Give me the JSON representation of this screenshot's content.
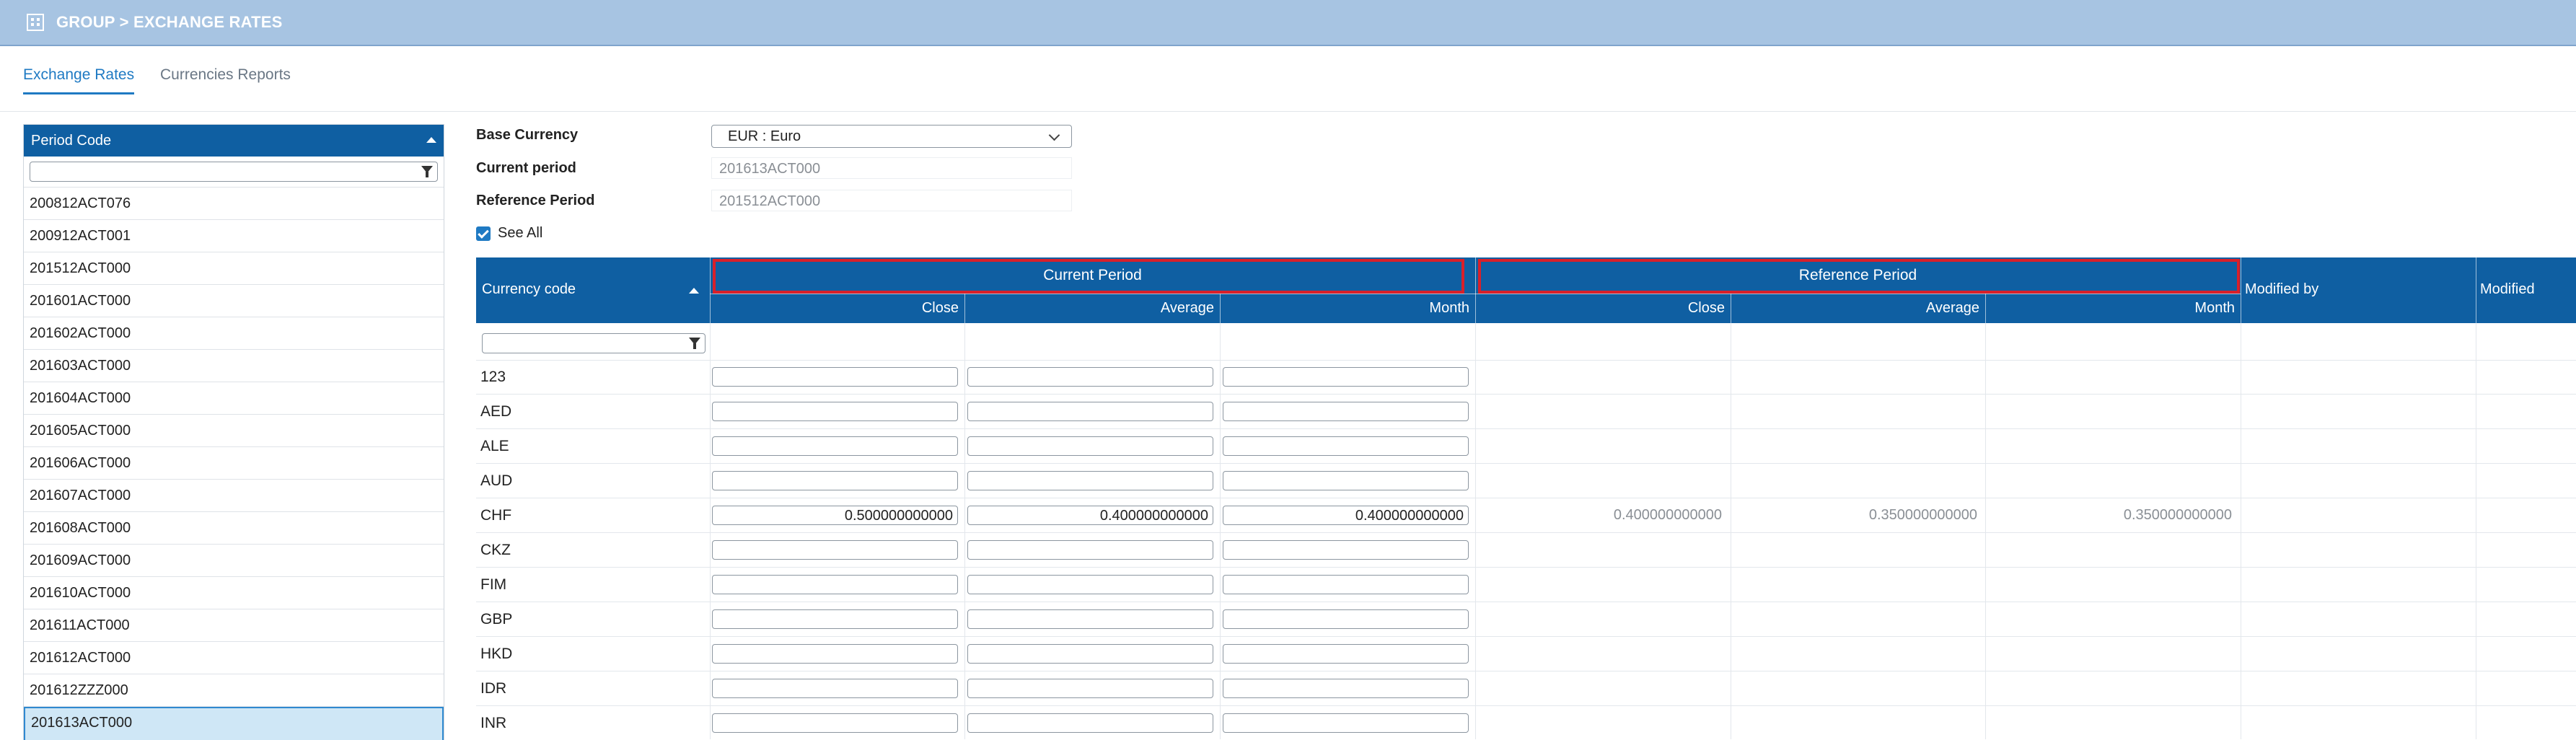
{
  "header": {
    "title": "GROUP > EXCHANGE RATES",
    "icon": "building-icon"
  },
  "tabs": [
    {
      "label": "Exchange Rates",
      "active": true
    },
    {
      "label": "Currencies Reports",
      "active": false
    }
  ],
  "period_panel": {
    "header": "Period Code",
    "filter_value": "",
    "items": [
      "200812ACT076",
      "200912ACT001",
      "201512ACT000",
      "201601ACT000",
      "201602ACT000",
      "201603ACT000",
      "201604ACT000",
      "201605ACT000",
      "201606ACT000",
      "201607ACT000",
      "201608ACT000",
      "201609ACT000",
      "201610ACT000",
      "201611ACT000",
      "201612ACT000",
      "201612ZZZ000",
      "201613ACT000"
    ],
    "selected": "201613ACT000"
  },
  "form": {
    "base_currency_label": "Base Currency",
    "base_currency_value": "EUR : Euro",
    "current_period_label": "Current period",
    "current_period_value": "201613ACT000",
    "reference_period_label": "Reference Period",
    "reference_period_value": "201512ACT000",
    "see_all_label": "See All",
    "see_all_checked": true
  },
  "grid": {
    "currency_code_header": "Currency code",
    "current_period_header": "Current Period",
    "reference_period_header": "Reference Period",
    "modified_by_header": "Modified by",
    "modified_header": "Modified",
    "sub_headers": {
      "close": "Close",
      "average": "Average",
      "month": "Month"
    },
    "rows": [
      {
        "code": "123",
        "cur": [
          "",
          "",
          ""
        ],
        "ref": [
          "",
          "",
          ""
        ]
      },
      {
        "code": "AED",
        "cur": [
          "",
          "",
          ""
        ],
        "ref": [
          "",
          "",
          ""
        ]
      },
      {
        "code": "ALE",
        "cur": [
          "",
          "",
          ""
        ],
        "ref": [
          "",
          "",
          ""
        ]
      },
      {
        "code": "AUD",
        "cur": [
          "",
          "",
          ""
        ],
        "ref": [
          "",
          "",
          ""
        ]
      },
      {
        "code": "CHF",
        "cur": [
          "0.500000000000",
          "0.400000000000",
          "0.400000000000"
        ],
        "ref": [
          "0.400000000000",
          "0.350000000000",
          "0.350000000000"
        ]
      },
      {
        "code": "CKZ",
        "cur": [
          "",
          "",
          ""
        ],
        "ref": [
          "",
          "",
          ""
        ]
      },
      {
        "code": "FIM",
        "cur": [
          "",
          "",
          ""
        ],
        "ref": [
          "",
          "",
          ""
        ]
      },
      {
        "code": "GBP",
        "cur": [
          "",
          "",
          ""
        ],
        "ref": [
          "",
          "",
          ""
        ]
      },
      {
        "code": "HKD",
        "cur": [
          "",
          "",
          ""
        ],
        "ref": [
          "",
          "",
          ""
        ]
      },
      {
        "code": "IDR",
        "cur": [
          "",
          "",
          ""
        ],
        "ref": [
          "",
          "",
          ""
        ]
      },
      {
        "code": "INR",
        "cur": [
          "",
          "",
          ""
        ],
        "ref": [
          "",
          "",
          ""
        ]
      }
    ]
  },
  "colors": {
    "header_bar": "#a7c4e2",
    "grid_header": "#0f5fa2",
    "accent": "#1f7ac3",
    "highlight": "#d8202a"
  }
}
